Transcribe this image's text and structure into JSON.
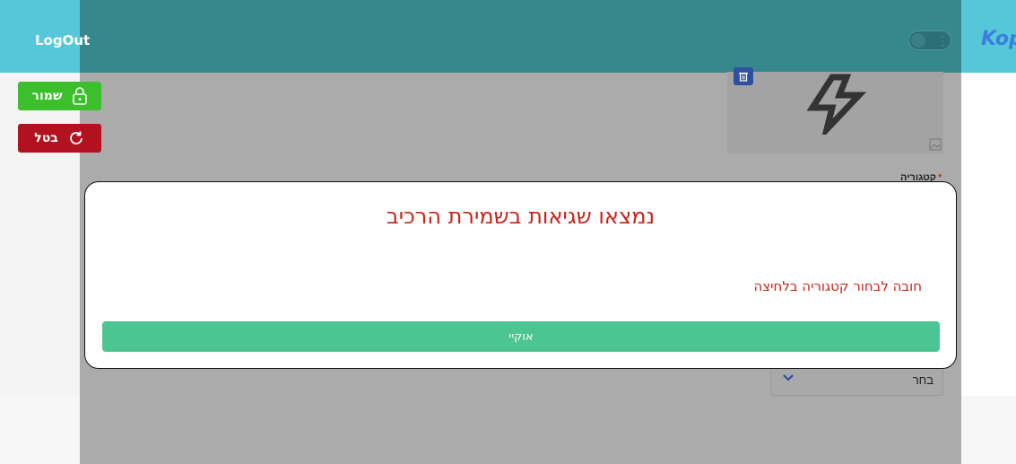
{
  "header": {
    "logout_label": "LogOut",
    "brand_text": "Kop",
    "theme_toggle_state": "off"
  },
  "actions": {
    "save_label": "שמור",
    "cancel_label": "בטל"
  },
  "form": {
    "category_label": "קטגוריה",
    "select_value": "בחר"
  },
  "modal": {
    "title": "נמצאו שגיאות בשמירת הרכיב",
    "error_message": "חובה לבחור קטגוריה בלחיצה",
    "ok_label": "אוקיי"
  },
  "colors": {
    "accent": "#56c7d8",
    "save": "#3bbf2c",
    "cancel": "#b2121f",
    "error_text": "#c8231b",
    "ok_button": "#4bc592"
  },
  "icons": [
    "lock-icon",
    "refresh-icon",
    "trash-icon",
    "lightning-icon",
    "image-icon",
    "chevron-down-icon"
  ]
}
